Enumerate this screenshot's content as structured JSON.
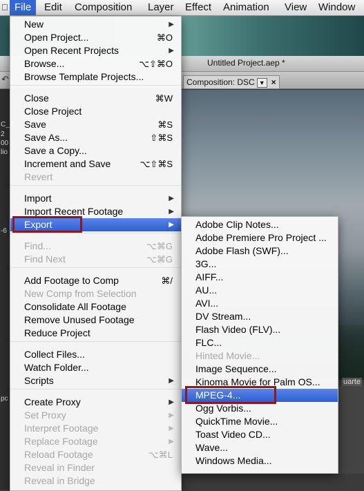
{
  "menubar": {
    "items": [
      "File",
      "Edit",
      "Composition",
      "Layer",
      "Effect",
      "Animation",
      "View",
      "Window"
    ],
    "apple_icon": "apple-icon"
  },
  "app": {
    "window_title": "Untitled Project.aep *",
    "composition_tab": "Composition: DSC",
    "left_panel_fragments": [
      "C_6",
      "2",
      "00",
      "lio",
      "-6",
      "pc"
    ],
    "timeline_label": "uarte"
  },
  "file_menu": {
    "items": [
      {
        "label": "New",
        "shortcut": "",
        "submenu": true,
        "disabled": false
      },
      {
        "label": "Open Project...",
        "shortcut": "⌘O",
        "submenu": false,
        "disabled": false
      },
      {
        "label": "Open Recent Projects",
        "shortcut": "",
        "submenu": true,
        "disabled": false
      },
      {
        "label": "Browse...",
        "shortcut": "⌥⇧⌘O",
        "submenu": false,
        "disabled": false
      },
      {
        "label": "Browse Template Projects...",
        "shortcut": "",
        "submenu": false,
        "disabled": false
      },
      {
        "label": "Close",
        "shortcut": "⌘W",
        "submenu": false,
        "disabled": false
      },
      {
        "label": "Close Project",
        "shortcut": "",
        "submenu": false,
        "disabled": false
      },
      {
        "label": "Save",
        "shortcut": "⌘S",
        "submenu": false,
        "disabled": false
      },
      {
        "label": "Save As...",
        "shortcut": "⇧⌘S",
        "submenu": false,
        "disabled": false
      },
      {
        "label": "Save a Copy...",
        "shortcut": "",
        "submenu": false,
        "disabled": false
      },
      {
        "label": "Increment and Save",
        "shortcut": "⌥⇧⌘S",
        "submenu": false,
        "disabled": false
      },
      {
        "label": "Revert",
        "shortcut": "",
        "submenu": false,
        "disabled": true
      },
      {
        "label": "Import",
        "shortcut": "",
        "submenu": true,
        "disabled": false
      },
      {
        "label": "Import Recent Footage",
        "shortcut": "",
        "submenu": true,
        "disabled": false
      },
      {
        "label": "Export",
        "shortcut": "",
        "submenu": true,
        "disabled": false
      },
      {
        "label": "Find...",
        "shortcut": "⌥⌘G",
        "submenu": false,
        "disabled": true
      },
      {
        "label": "Find Next",
        "shortcut": "⌥⌘G",
        "submenu": false,
        "disabled": true
      },
      {
        "label": "Add Footage to Comp",
        "shortcut": "⌘/",
        "submenu": false,
        "disabled": false
      },
      {
        "label": "New Comp from Selection",
        "shortcut": "",
        "submenu": false,
        "disabled": true
      },
      {
        "label": "Consolidate All Footage",
        "shortcut": "",
        "submenu": false,
        "disabled": false
      },
      {
        "label": "Remove Unused Footage",
        "shortcut": "",
        "submenu": false,
        "disabled": false
      },
      {
        "label": "Reduce Project",
        "shortcut": "",
        "submenu": false,
        "disabled": false
      },
      {
        "label": "Collect Files...",
        "shortcut": "",
        "submenu": false,
        "disabled": false
      },
      {
        "label": "Watch Folder...",
        "shortcut": "",
        "submenu": false,
        "disabled": false
      },
      {
        "label": "Scripts",
        "shortcut": "",
        "submenu": true,
        "disabled": false
      },
      {
        "label": "Create Proxy",
        "shortcut": "",
        "submenu": true,
        "disabled": false
      },
      {
        "label": "Set Proxy",
        "shortcut": "",
        "submenu": true,
        "disabled": true
      },
      {
        "label": "Interpret Footage",
        "shortcut": "",
        "submenu": true,
        "disabled": true
      },
      {
        "label": "Replace Footage",
        "shortcut": "",
        "submenu": true,
        "disabled": true
      },
      {
        "label": "Reload Footage",
        "shortcut": "⌥⌘L",
        "submenu": false,
        "disabled": true
      },
      {
        "label": "Reveal in Finder",
        "shortcut": "",
        "submenu": false,
        "disabled": true
      },
      {
        "label": "Reveal in Bridge",
        "shortcut": "",
        "submenu": false,
        "disabled": true
      }
    ]
  },
  "export_menu": {
    "items": [
      {
        "label": "Adobe Clip Notes...",
        "disabled": false
      },
      {
        "label": "Adobe Premiere Pro Project ...",
        "disabled": false
      },
      {
        "label": "Adobe Flash (SWF)...",
        "disabled": false
      },
      {
        "label": "3G...",
        "disabled": false
      },
      {
        "label": "AIFF...",
        "disabled": false
      },
      {
        "label": "AU...",
        "disabled": false
      },
      {
        "label": "AVI...",
        "disabled": false
      },
      {
        "label": "DV Stream...",
        "disabled": false
      },
      {
        "label": "Flash Video (FLV)...",
        "disabled": false
      },
      {
        "label": "FLC...",
        "disabled": false
      },
      {
        "label": "Hinted Movie...",
        "disabled": true
      },
      {
        "label": "Image Sequence...",
        "disabled": false
      },
      {
        "label": "Kinoma Movie for Palm OS...",
        "disabled": false
      },
      {
        "label": "MPEG-4...",
        "disabled": false
      },
      {
        "label": "Ogg Vorbis...",
        "disabled": false
      },
      {
        "label": "QuickTime Movie...",
        "disabled": false
      },
      {
        "label": "Toast Video CD...",
        "disabled": false
      },
      {
        "label": "Wave...",
        "disabled": false
      },
      {
        "label": "Windows Media...",
        "disabled": false
      }
    ]
  },
  "colors": {
    "highlight": "#2f5fd4",
    "callout": "#8a1a22"
  }
}
